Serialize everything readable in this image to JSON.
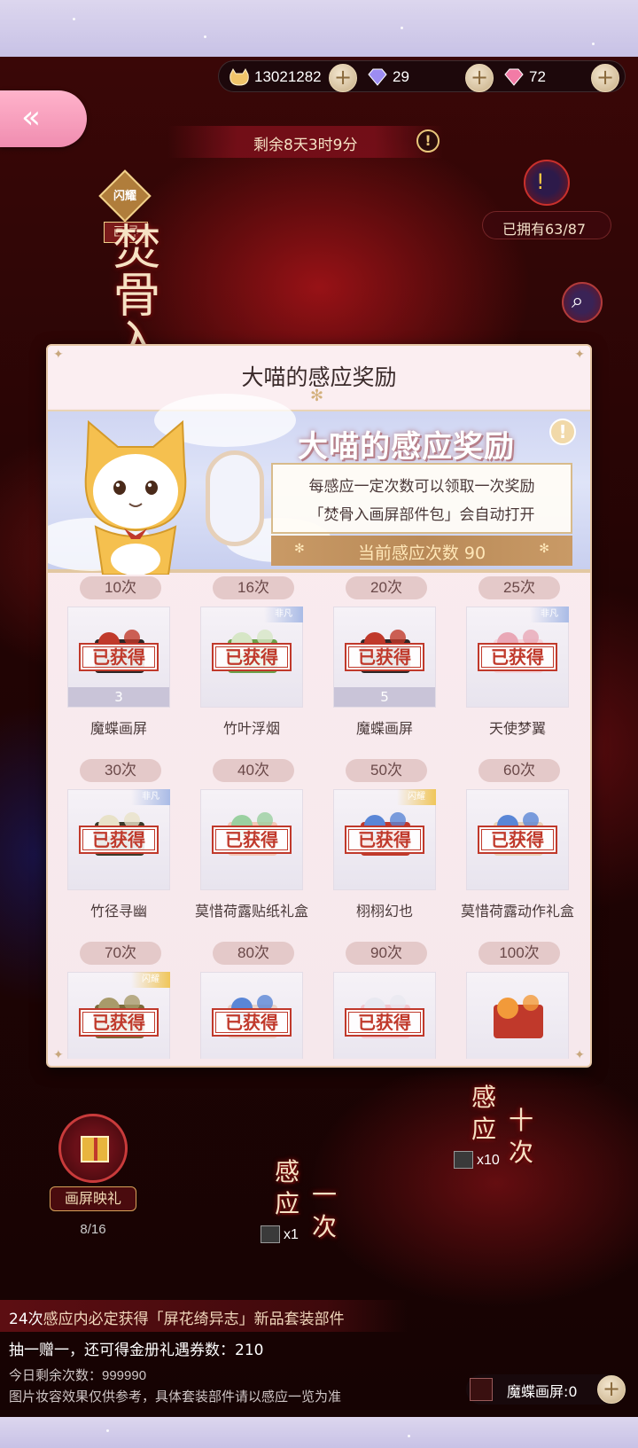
{
  "currency": {
    "coins": "13021282",
    "diamonds": "29",
    "pink_diamonds": "72",
    "plus": "+"
  },
  "back": {
    "label": "«"
  },
  "timer": {
    "text": "剩余8天3时9分",
    "info": "!"
  },
  "warning": {
    "icon": "!"
  },
  "owned": {
    "text": "已拥有63/87"
  },
  "search": {
    "icon": "⌕"
  },
  "event": {
    "flash_tag": "闪耀",
    "screen_tag": "画屏",
    "title": "焚骨入画"
  },
  "modal": {
    "title": "大喵的感应奖励",
    "banner_heading": "大喵的感应奖励",
    "info": "!",
    "desc_line1": "每感应一定次数可以领取一次奖励",
    "desc_line2": "「焚骨入画屏部件包」会自动打开",
    "current_count": "当前感应次数 90"
  },
  "rewards": [
    {
      "count": "10次",
      "name": "魔蝶画屏",
      "stamp": "已获得",
      "qty": "3",
      "ribbon": ""
    },
    {
      "count": "16次",
      "name": "竹叶浮烟",
      "stamp": "已获得",
      "qty": "",
      "ribbon": "非凡"
    },
    {
      "count": "20次",
      "name": "魔蝶画屏",
      "stamp": "已获得",
      "qty": "5",
      "ribbon": ""
    },
    {
      "count": "25次",
      "name": "天使梦翼",
      "stamp": "已获得",
      "qty": "",
      "ribbon": "非凡"
    },
    {
      "count": "30次",
      "name": "竹径寻幽",
      "stamp": "已获得",
      "qty": "",
      "ribbon": "非凡"
    },
    {
      "count": "40次",
      "name": "莫惜荷露贴纸礼盒",
      "stamp": "已获得",
      "qty": "",
      "ribbon": ""
    },
    {
      "count": "50次",
      "name": "栩栩幻也",
      "stamp": "已获得",
      "qty": "",
      "ribbon": "闪耀"
    },
    {
      "count": "60次",
      "name": "莫惜荷露动作礼盒",
      "stamp": "已获得",
      "qty": "",
      "ribbon": ""
    },
    {
      "count": "70次",
      "name": "",
      "stamp": "已获得",
      "qty": "",
      "ribbon": "闪耀"
    },
    {
      "count": "80次",
      "name": "",
      "stamp": "已获得",
      "qty": "",
      "ribbon": ""
    },
    {
      "count": "90次",
      "name": "",
      "stamp": "已获得",
      "qty": "",
      "ribbon": ""
    },
    {
      "count": "100次",
      "name": "",
      "stamp": "",
      "qty": "",
      "ribbon": ""
    }
  ],
  "gift": {
    "label": "画屏映礼",
    "progress": "8/16"
  },
  "draw_once": {
    "g1": "感",
    "g2": "应",
    "g3": "一",
    "g4": "次",
    "cost": "x1"
  },
  "draw_ten": {
    "g1": "感",
    "g2": "应",
    "g3": "十",
    "g4": "次",
    "cost": "x10"
  },
  "notice": {
    "highlight": "24次",
    "text": "感应内必定获得「屏花绮异志」新品套装部件"
  },
  "bonus": {
    "text": "抽一赠一，还可得金册礼遇券数：210"
  },
  "remaining": {
    "text": "今日剩余次数：999990"
  },
  "disclaimer": {
    "text": "图片妆容效果仅供参考，具体套装部件请以感应一览为准"
  },
  "chip": {
    "label": "魔蝶画屏:0"
  },
  "colors": {
    "accent_pink": "#f08db0",
    "stamp_red": "#c0392b",
    "gold": "#c99a66"
  }
}
